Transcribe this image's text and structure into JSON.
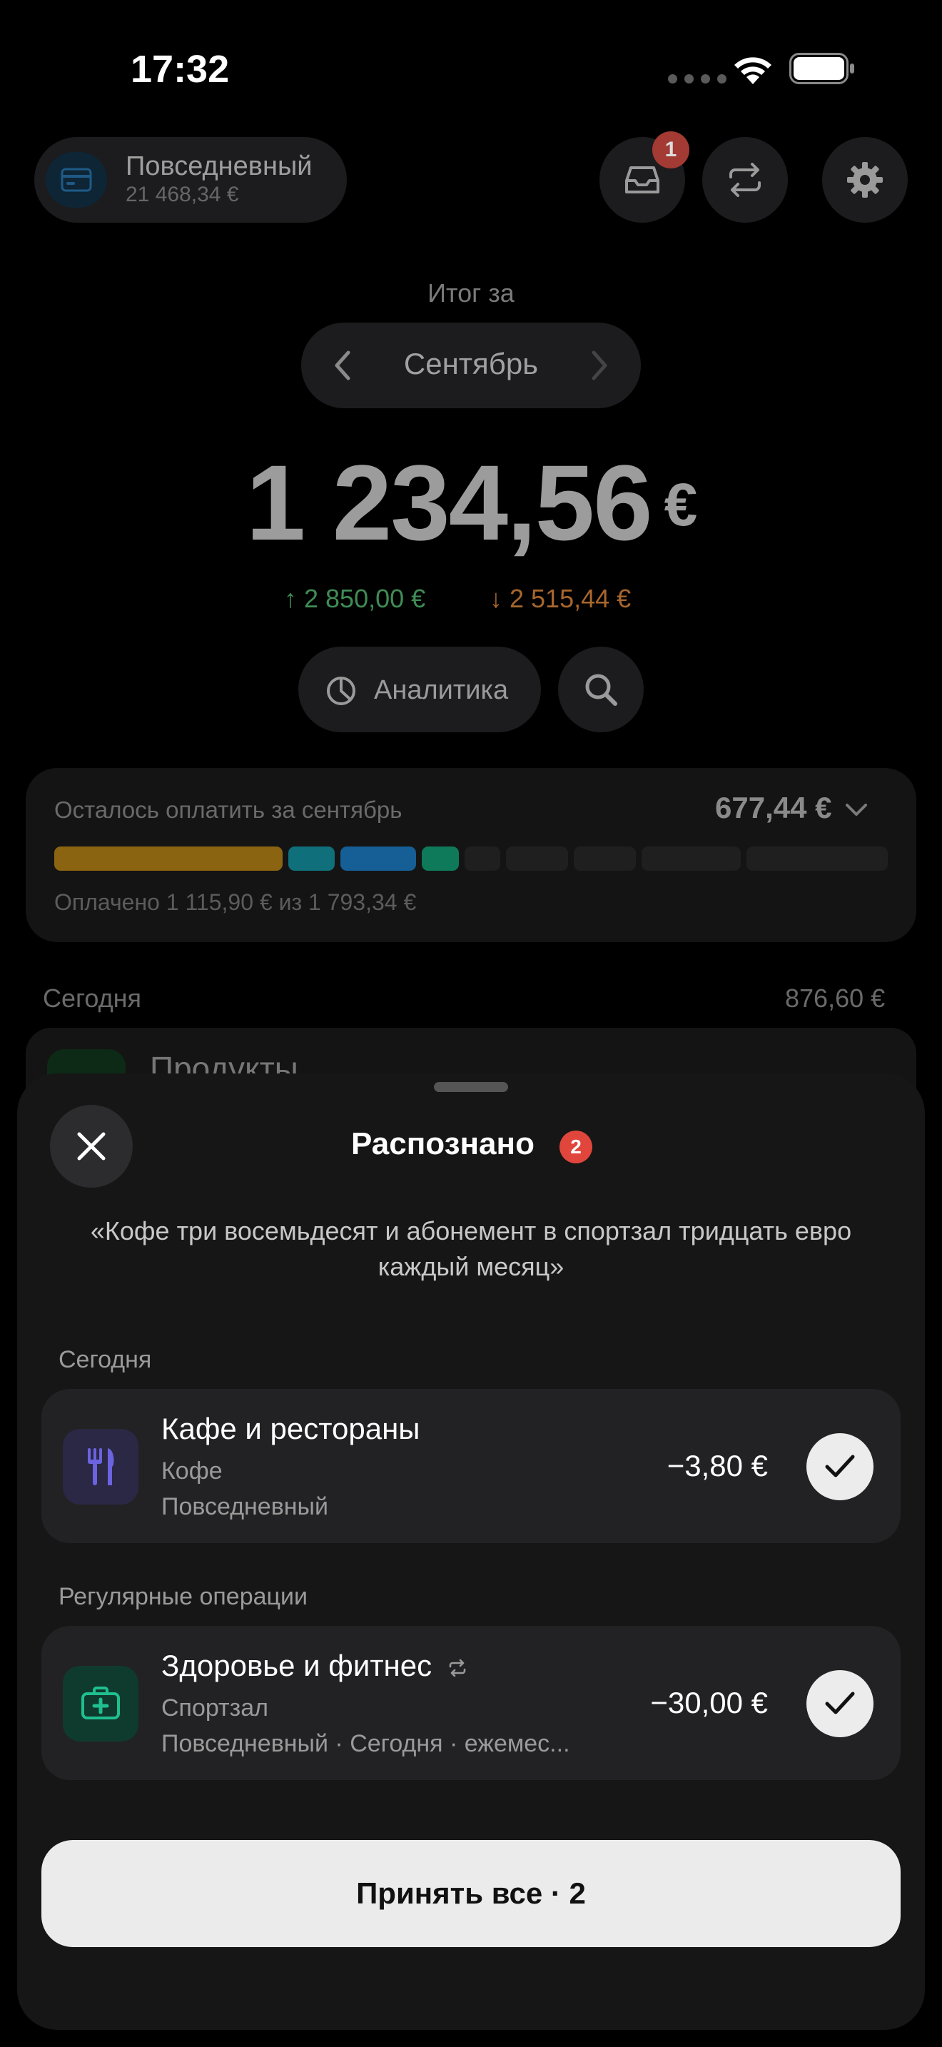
{
  "status_bar": {
    "time": "17:32"
  },
  "account": {
    "name": "Повседневный",
    "balance": "21 468,34 €"
  },
  "header": {
    "inbox_badge": "1"
  },
  "summary": {
    "period_label": "Итог за",
    "month": "Сентябрь",
    "total": "1 234,56",
    "currency": "€",
    "income": "2 850,00 €",
    "expense": "2 515,44 €",
    "analytics_label": "Аналитика"
  },
  "payments": {
    "title": "Осталось оплатить за сентябрь",
    "remaining": "677,44 €",
    "paid_text": "Оплачено 1 115,90 € из 1 793,34 €",
    "paid_fraction": 0.622,
    "segments": [
      {
        "weight": 258,
        "color": "#8a6410"
      },
      {
        "weight": 52,
        "color": "#0f6f7a"
      },
      {
        "weight": 86,
        "color": "#155e96"
      },
      {
        "weight": 42,
        "color": "#0e7a5a"
      },
      {
        "weight": 40,
        "color": "#1f1f1f"
      },
      {
        "weight": 70,
        "color": "#1f1f1f"
      },
      {
        "weight": 70,
        "color": "#1f1f1f"
      },
      {
        "weight": 112,
        "color": "#1f1f1f"
      },
      {
        "weight": 160,
        "color": "#1f1f1f"
      }
    ]
  },
  "background_list": {
    "section": "Сегодня",
    "section_sum": "876,60 €",
    "first_row_title": "Продукты"
  },
  "sheet": {
    "title": "Распознано",
    "badge": "2",
    "transcript": "«Кофе три восемьдесят и абонемент в спортзал тридцать евро каждый месяц»",
    "sections": [
      {
        "label": "Сегодня",
        "item": {
          "category": "Кафе и рестораны",
          "note": "Кофе",
          "meta": "Повседневный",
          "amount": "−3,80 €",
          "icon": "fork-knife-icon",
          "icon_color": "#6b63e0",
          "icon_bg": "#2a2845"
        }
      },
      {
        "label": "Регулярные операции",
        "item": {
          "category": "Здоровье и фитнес",
          "note": "Спортзал",
          "meta": "Повседневный · Сегодня · ежемес...",
          "amount": "−30,00 €",
          "icon": "first-aid-kit-icon",
          "icon_color": "#1fbf8f",
          "icon_bg": "#0f3a2e"
        }
      }
    ],
    "accept_label": "Принять все · 2"
  }
}
